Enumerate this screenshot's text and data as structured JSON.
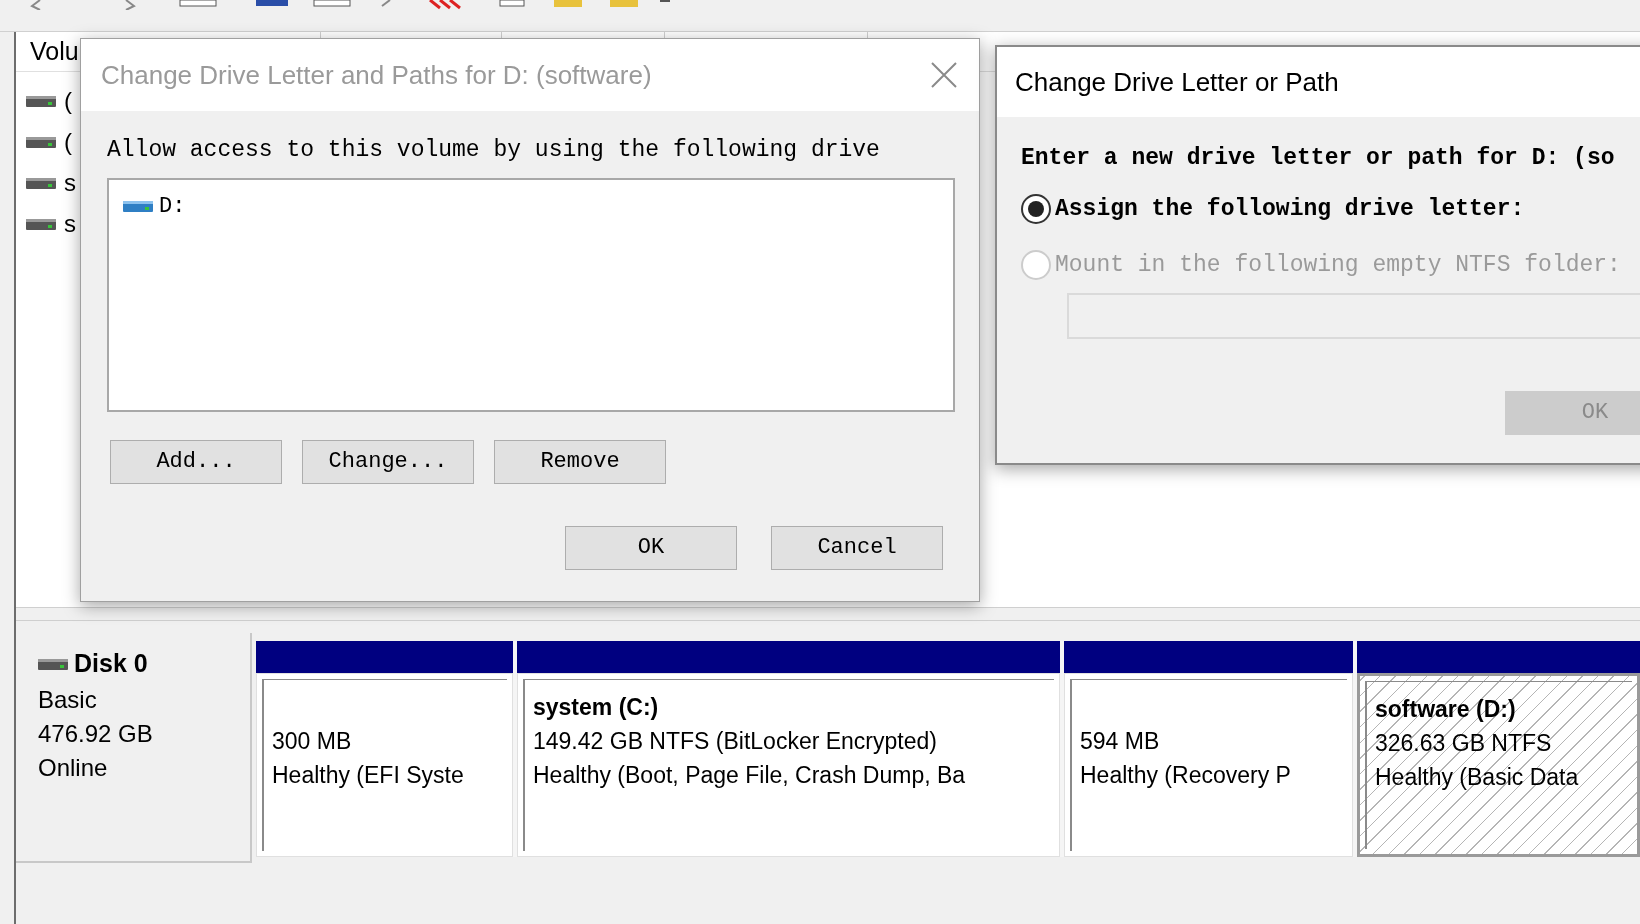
{
  "volume_list": {
    "column_1": "Volu",
    "rows": [
      {
        "name": "("
      },
      {
        "name": "("
      },
      {
        "name": "s"
      },
      {
        "name": "s"
      }
    ]
  },
  "paths_dialog": {
    "title": "Change Drive Letter and Paths for D: (software)",
    "description": "Allow access to this volume by using the following drive",
    "drives": [
      {
        "label": "D:",
        "selected": false
      }
    ],
    "buttons": [
      "Add...",
      "Change...",
      "Remove"
    ],
    "footer_buttons": [
      "OK",
      "Cancel"
    ]
  },
  "letter_dialog": {
    "title": "Change Drive Letter or Path",
    "prompt": "Enter a new drive letter or path for D: (so",
    "options": [
      {
        "label": "Assign the following drive letter:",
        "selected": true,
        "disabled": false
      },
      {
        "label": "Mount in the following empty NTFS folder:",
        "selected": false,
        "disabled": true
      }
    ],
    "folder_field": {
      "disabled": true
    },
    "ok_button": {
      "label": "OK",
      "disabled": true
    }
  },
  "disk": {
    "name": "Disk 0",
    "type": "Basic",
    "size": "476.92 GB",
    "status": "Online",
    "partitions": [
      {
        "size": "300 MB",
        "health": "Healthy (EFI Syste",
        "selected": false
      },
      {
        "name": "system  (C:)",
        "size": "149.42 GB NTFS (BitLocker Encrypted)",
        "health": "Healthy (Boot, Page File, Crash Dump, Ba",
        "selected": false
      },
      {
        "size": "594 MB",
        "health": "Healthy (Recovery P",
        "selected": false
      },
      {
        "name": "software  (D:)",
        "size": "326.63 GB NTFS",
        "health": "Healthy (Basic Data",
        "selected": true
      }
    ]
  }
}
